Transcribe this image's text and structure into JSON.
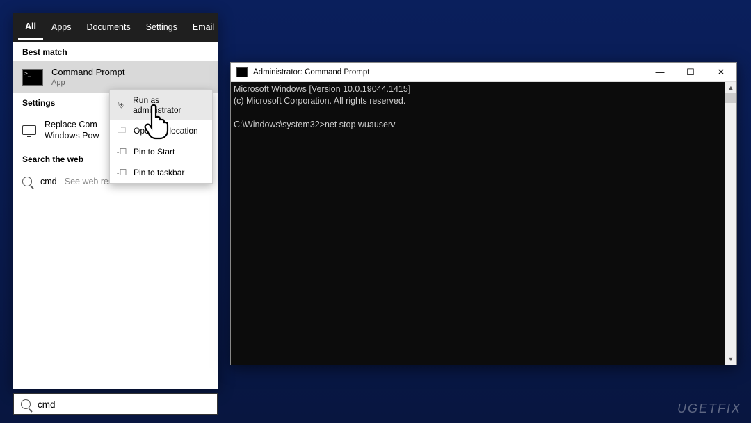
{
  "start_menu": {
    "tabs": [
      "All",
      "Apps",
      "Documents",
      "Settings",
      "Email"
    ],
    "best_match_label": "Best match",
    "best_match": {
      "title": "Command Prompt",
      "subtitle": "App"
    },
    "settings_label": "Settings",
    "setting_item": "Replace Command Prompt with Windows PowerShell",
    "setting_item_visible": "Replace Com\nWindows Pow",
    "search_web_label": "Search the web",
    "web_item": {
      "query": "cmd",
      "suffix": " - See web results"
    }
  },
  "context_menu": {
    "items": [
      {
        "label": "Run as administrator",
        "icon": "admin-icon"
      },
      {
        "label": "Open file location",
        "icon": "folder-icon"
      },
      {
        "label": "Pin to Start",
        "icon": "pin-start-icon"
      },
      {
        "label": "Pin to taskbar",
        "icon": "pin-taskbar-icon"
      }
    ]
  },
  "search_box": {
    "value": "cmd"
  },
  "cmd_window": {
    "title": "Administrator: Command Prompt",
    "lines": [
      "Microsoft Windows [Version 10.0.19044.1415]",
      "(c) Microsoft Corporation. All rights reserved.",
      "",
      "C:\\Windows\\system32>net stop wuauserv"
    ]
  },
  "watermark": "UGETFIX",
  "icons": {
    "admin": "⛨",
    "folder": "🗀",
    "pin_start": "📌",
    "pin_taskbar": "📌",
    "minimize": "—",
    "maximize": "☐",
    "close": "✕",
    "chevron": "›",
    "scroll_up": "▲",
    "scroll_down": "▼"
  }
}
